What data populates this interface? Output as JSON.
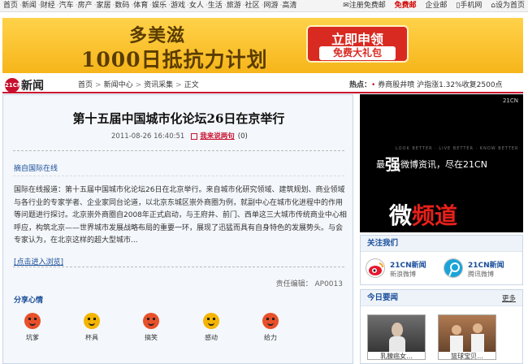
{
  "topnav": {
    "links": [
      "首页",
      "新闻",
      "财经",
      "汽车",
      "房产",
      "家居",
      "数码",
      "体育",
      "娱乐",
      "游戏",
      "女人",
      "生活",
      "旅游",
      "社区",
      "网游",
      "高清"
    ],
    "register": "注册免费邮",
    "free_mail": "免费邮",
    "enterprise": "企业邮",
    "mobile": "手机网",
    "set_home": "设为首页"
  },
  "banner": {
    "line1": "多美滋",
    "line2": "1000日抵抗力计划",
    "cta_main": "立即申领",
    "cta_sub": "免费大礼包",
    "colors": {
      "bg": "#f8c630",
      "cta": "#d92a22"
    }
  },
  "site": {
    "logo_mark": "21CN",
    "logo_name": "新闻",
    "breadcrumb": [
      "首页",
      "新闻中心",
      "资讯采集",
      "正文"
    ],
    "hot_label": "热点：",
    "hot_text": "券商股井喷 沪指涨1.32%收复2500点",
    "accent": "#c8102e"
  },
  "article": {
    "title": "第十五届中国城市化论坛26日在京举行",
    "datetime": "2011-08-26 16:40:51",
    "comment_link": "我来说两句",
    "comment_count": "(0)",
    "source": "摘自国际在线",
    "body": "国际在线报道：第十五届中国城市化论坛26日在北京举行。来自城市化研究领域、建筑规划、商业领域与各行业的专家学者、企业家同台论道，以北京东城区崇外商圈为例，就副中心在城市化进程中的作用等问题进行探讨。北京崇外商圈自2008年正式启动，与王府井、前门、西单这三大城市传统商业中心相呼应，构筑北京——世界城市发展战略布局的重要一环，展现了迅猛而具有自身特色的发展势头。与会专家认为，在北京这样的超大型城市...",
    "read_more": "[点击进入浏览]",
    "editor": "责任编辑：  AP0013",
    "share_title": "分享心情",
    "moods": [
      {
        "label": "坑爹",
        "icon": "angry-face-icon",
        "color": "#e8502a"
      },
      {
        "label": "杯具",
        "icon": "sad-face-icon",
        "color": "#f4b400"
      },
      {
        "label": "搞笑",
        "icon": "laugh-face-icon",
        "color": "#e8502a"
      },
      {
        "label": "感动",
        "icon": "moved-face-icon",
        "color": "#f4b400"
      },
      {
        "label": "给力",
        "icon": "cheer-face-icon",
        "color": "#e8502a"
      }
    ]
  },
  "sidebar": {
    "video": {
      "tag": "21CN",
      "english": "LOOK BETTER · LIVE BETTER · KNOW BETTER",
      "line_pre": "最",
      "line_strong": "强",
      "line_post": "微博资讯，尽在21CN",
      "big_a": "微",
      "big_b": "频道"
    },
    "follow": {
      "title": "关注我们",
      "items": [
        {
          "name": "21CN新闻",
          "sub": "新浪微博",
          "icon": "weibo-icon"
        },
        {
          "name": "21CN新闻",
          "sub": "腾讯微博",
          "icon": "tencent-weibo-icon"
        }
      ]
    },
    "today": {
      "title": "今日要闻",
      "more": "更多",
      "items": [
        {
          "caption": "乳腺癌女..."
        },
        {
          "caption": "篮球宝贝..."
        }
      ]
    }
  }
}
